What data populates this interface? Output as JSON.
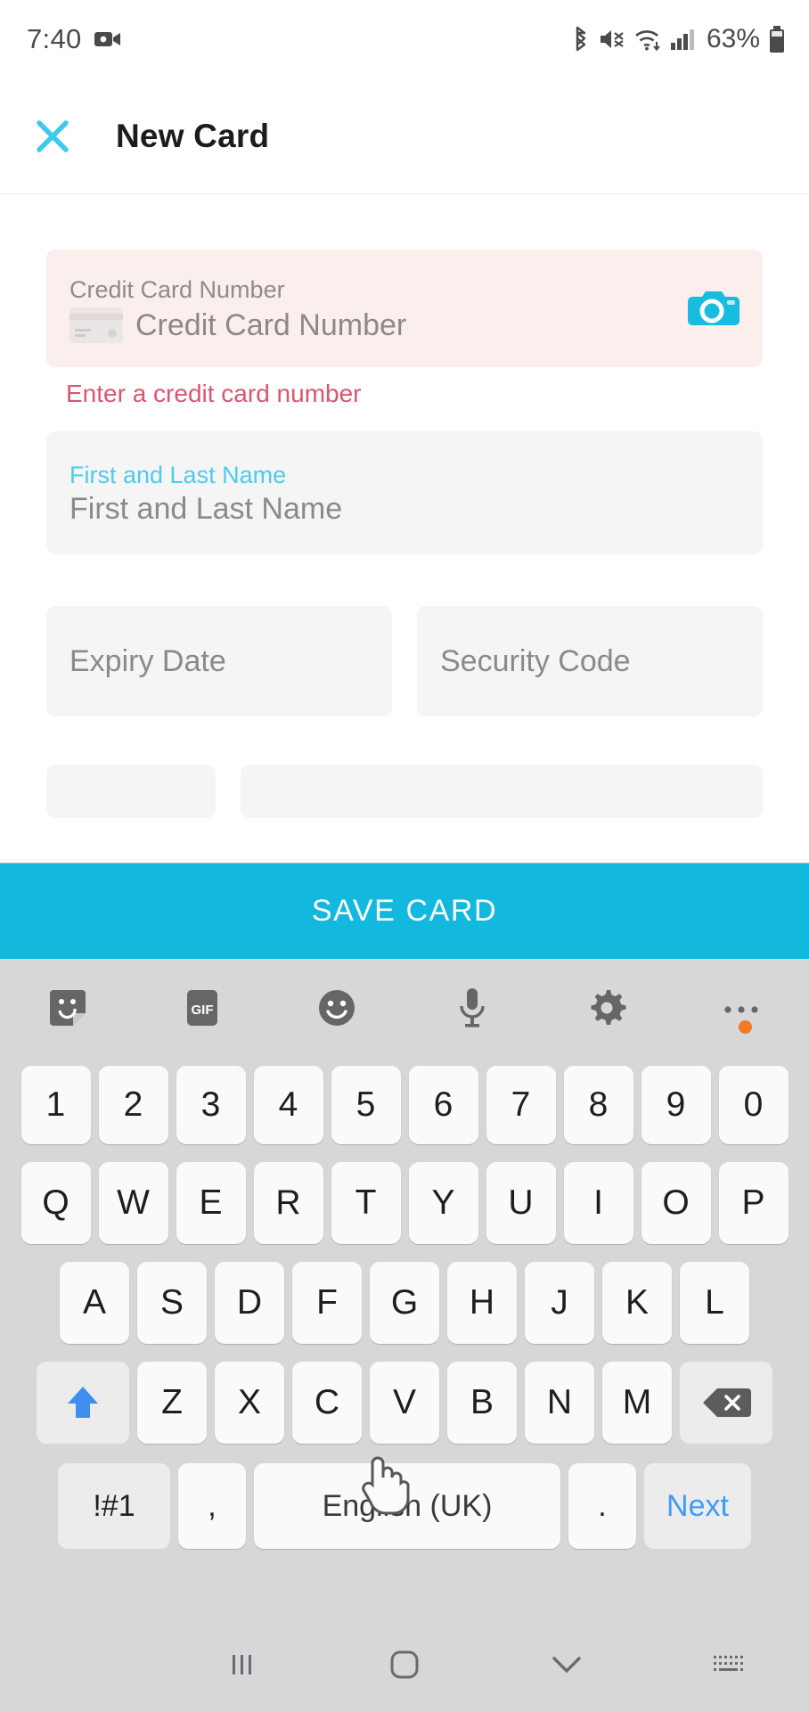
{
  "status_bar": {
    "time": "7:40",
    "battery_percent": "63%",
    "icons": [
      "video-recording-icon",
      "bluetooth-icon",
      "mute-icon",
      "wifi-icon",
      "cellular-signal-icon",
      "battery-icon"
    ]
  },
  "app_bar": {
    "close_icon": "close-icon",
    "title": "New Card"
  },
  "form": {
    "credit_card": {
      "label": "Credit Card Number",
      "placeholder": "Credit Card Number",
      "value": "",
      "error": "Enter a credit card number",
      "scan_icon": "camera-icon",
      "card_icon": "credit-card-icon",
      "state": "error"
    },
    "name": {
      "label": "First and Last Name",
      "placeholder": "First and Last Name",
      "value": "",
      "state": "focused"
    },
    "expiry": {
      "placeholder": "Expiry Date",
      "value": ""
    },
    "security": {
      "placeholder": "Security Code",
      "value": ""
    }
  },
  "save_button": {
    "label": "SAVE CARD"
  },
  "keyboard": {
    "toolbar": [
      {
        "name": "sticker-icon"
      },
      {
        "name": "gif-icon",
        "label": "GIF"
      },
      {
        "name": "emoji-icon"
      },
      {
        "name": "microphone-icon"
      },
      {
        "name": "settings-gear-icon"
      },
      {
        "name": "more-options-icon",
        "badge": true
      }
    ],
    "rows": {
      "numbers": [
        "1",
        "2",
        "3",
        "4",
        "5",
        "6",
        "7",
        "8",
        "9",
        "0"
      ],
      "top": [
        "Q",
        "W",
        "E",
        "R",
        "T",
        "Y",
        "U",
        "I",
        "O",
        "P"
      ],
      "home": [
        "A",
        "S",
        "D",
        "F",
        "G",
        "H",
        "J",
        "K",
        "L"
      ],
      "bottom": [
        "Z",
        "X",
        "C",
        "V",
        "B",
        "N",
        "M"
      ]
    },
    "shift_icon": "shift-up-arrow-icon",
    "backspace_icon": "backspace-icon",
    "symbols_key": "!#1",
    "comma_key": ",",
    "space_key": "English (UK)",
    "period_key": ".",
    "action_key": "Next"
  },
  "nav_bar": {
    "recents_icon": "recents-icon",
    "home_icon": "home-icon",
    "hide_keyboard_icon": "chevron-down-icon",
    "keyboard_switch_icon": "keyboard-icon"
  },
  "colors": {
    "accent": "#12b8dd",
    "error_text": "#d9566f",
    "error_bg": "#fbefee",
    "field_bg": "#f4f5f4",
    "keyboard_bg": "#d6d7d8",
    "shift_active": "#3f8ef0",
    "badge": "#f47920"
  }
}
